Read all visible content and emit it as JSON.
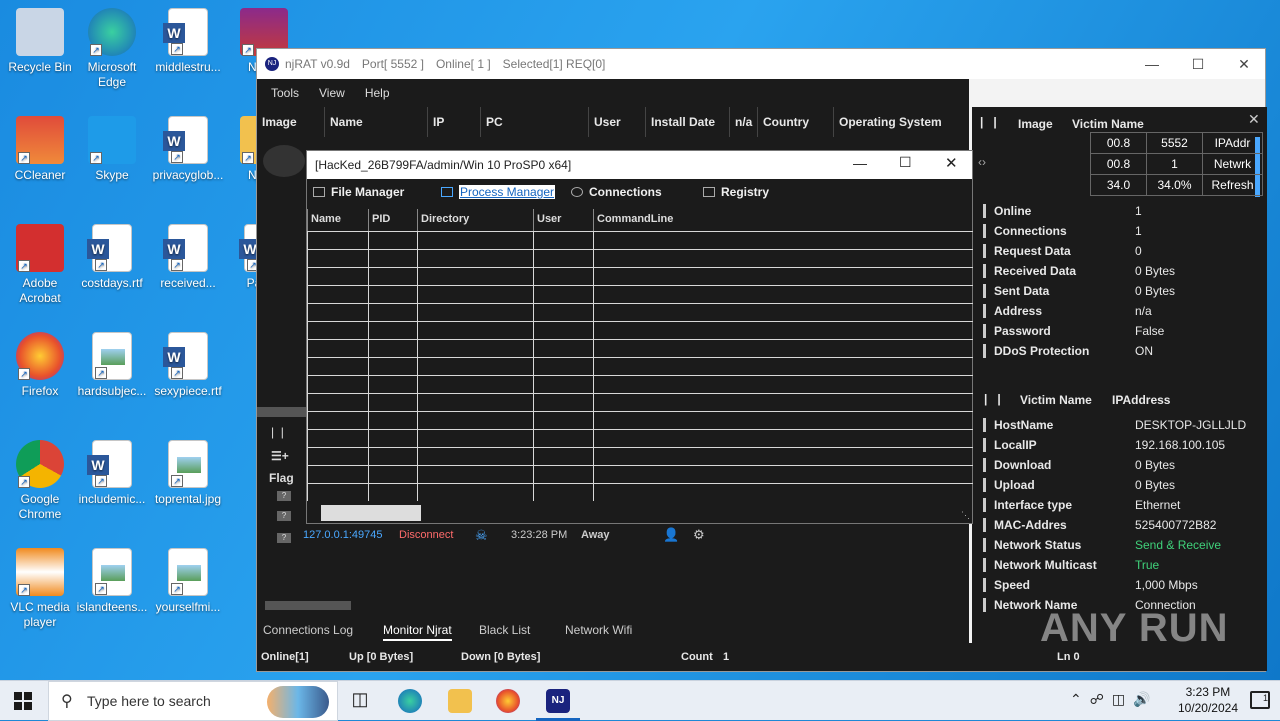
{
  "desktop": {
    "icons": [
      {
        "label": "Recycle Bin",
        "kind": "bin"
      },
      {
        "label": "Microsoft Edge",
        "kind": "edge"
      },
      {
        "label": "middlestru...",
        "kind": "doc"
      },
      {
        "label": "Njra...",
        "kind": "rar"
      },
      {
        "label": "CCleaner",
        "kind": "cc"
      },
      {
        "label": "Skype",
        "kind": "skype"
      },
      {
        "label": "privacyglob...",
        "kind": "doc"
      },
      {
        "label": "Njra...",
        "kind": "folder"
      },
      {
        "label": "Adobe Acrobat",
        "kind": "pdf"
      },
      {
        "label": "costdays.rtf",
        "kind": "doc"
      },
      {
        "label": "received...",
        "kind": "doc"
      },
      {
        "label": "Pate...",
        "kind": "doc"
      },
      {
        "label": "Firefox",
        "kind": "firefox"
      },
      {
        "label": "hardsubjec...",
        "kind": "img"
      },
      {
        "label": "sexypiece.rtf",
        "kind": "doc"
      },
      {
        "label": "Google Chrome",
        "kind": "chrome"
      },
      {
        "label": "includemic...",
        "kind": "doc"
      },
      {
        "label": "toprental.jpg",
        "kind": "img"
      },
      {
        "label": "VLC media player",
        "kind": "vlc"
      },
      {
        "label": "islandteens...",
        "kind": "img"
      },
      {
        "label": "yourselfmi...",
        "kind": "img"
      }
    ]
  },
  "main_window": {
    "title_app": "njRAT v0.9d",
    "title_port": "Port[ 5552 ]",
    "title_online": "Online[ 1 ]",
    "title_selected": "Selected[1] REQ[0]",
    "menu": [
      "Tools",
      "View",
      "Help"
    ],
    "columns": [
      "Image",
      "Name",
      "IP",
      "PC",
      "User",
      "Install Date",
      "n/a",
      "Country",
      "Operating System"
    ],
    "flag_label": "Flag",
    "client_row": {
      "ip": "127.0.0.1:49745",
      "action": "Disconnect",
      "time": "3:23:28 PM",
      "status": "Away"
    },
    "tabs": [
      "Connections Log",
      "Monitor Njrat",
      "Black List",
      "Network Wifi"
    ],
    "status": {
      "online": "Online[1]",
      "up": "Up [0 Bytes]",
      "down": "Down [0 Bytes]",
      "count_label": "Count",
      "count_value": "1",
      "ln": "Ln 0"
    }
  },
  "right_panel": {
    "header": {
      "image": "Image",
      "victim": "Victim Name"
    },
    "grid": [
      [
        "00.8",
        "5552",
        "IPAddr"
      ],
      [
        "00.8",
        "1",
        "Netwrk"
      ],
      [
        "34.0",
        "34.0%",
        "Refresh"
      ]
    ],
    "stats": [
      {
        "k": "Online",
        "v": "1"
      },
      {
        "k": "Connections",
        "v": "1"
      },
      {
        "k": "Request Data",
        "v": "0"
      },
      {
        "k": "Received Data",
        "v": "0 Bytes"
      },
      {
        "k": "Sent Data",
        "v": "0 Bytes"
      },
      {
        "k": "Address",
        "v": "n/a"
      },
      {
        "k": "Password",
        "v": "False"
      },
      {
        "k": "DDoS Protection",
        "v": "ON"
      }
    ],
    "net_header": {
      "victim": "Victim Name",
      "ip": "IPAddress"
    },
    "net": [
      {
        "k": "HostName",
        "v": "DESKTOP-JGLLJLD"
      },
      {
        "k": "LocalIP",
        "v": "192.168.100.105"
      },
      {
        "k": "Download",
        "v": "0 Bytes"
      },
      {
        "k": "Upload",
        "v": "0 Bytes"
      },
      {
        "k": "Interface type",
        "v": "Ethernet"
      },
      {
        "k": "MAC-Addres",
        "v": "525400772B82"
      },
      {
        "k": "Network Status",
        "v": "Send & Receive"
      },
      {
        "k": "Network Multicast",
        "v": "True"
      },
      {
        "k": "Speed",
        "v": "1,000 Mbps"
      },
      {
        "k": "Network Name",
        "v": "Connection"
      }
    ]
  },
  "dialog": {
    "title": "[HacKed_26B799FA/admin/Win 10 ProSP0 x64]",
    "tabs": [
      "File Manager",
      "Process Manager",
      "Connections",
      "Registry"
    ],
    "columns": [
      "Name",
      "PID",
      "Directory",
      "User",
      "CommandLine"
    ]
  },
  "taskbar": {
    "search_placeholder": "Type here to search",
    "time": "3:23 PM",
    "date": "10/20/2024",
    "notif_count": "1"
  },
  "watermark": "ANY RUN",
  "colors": {
    "accent_green": "#3fd17a",
    "link_blue": "#4aa8ff",
    "disconnect_red": "#ff6b6b"
  }
}
